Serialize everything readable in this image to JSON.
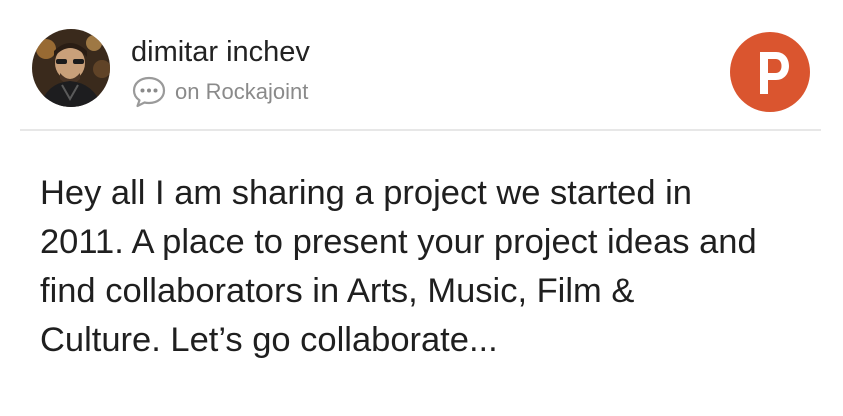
{
  "post": {
    "author_name": "dimitar inchev",
    "source_text": "on Rockajoint",
    "body_lines": [
      "Hey all I am sharing a project we started in",
      "2011. A place to present your project ideas and",
      "find collaborators in Arts, Music, Film &",
      "Culture. Let’s go collaborate..."
    ]
  },
  "icons": {
    "avatar": "user-avatar-photo",
    "comment": "speech-bubble-icon",
    "badge": "product-hunt-p-icon"
  },
  "colors": {
    "badge": "#da552f",
    "text": "#1f1f1f",
    "muted": "#8a8a8a"
  }
}
